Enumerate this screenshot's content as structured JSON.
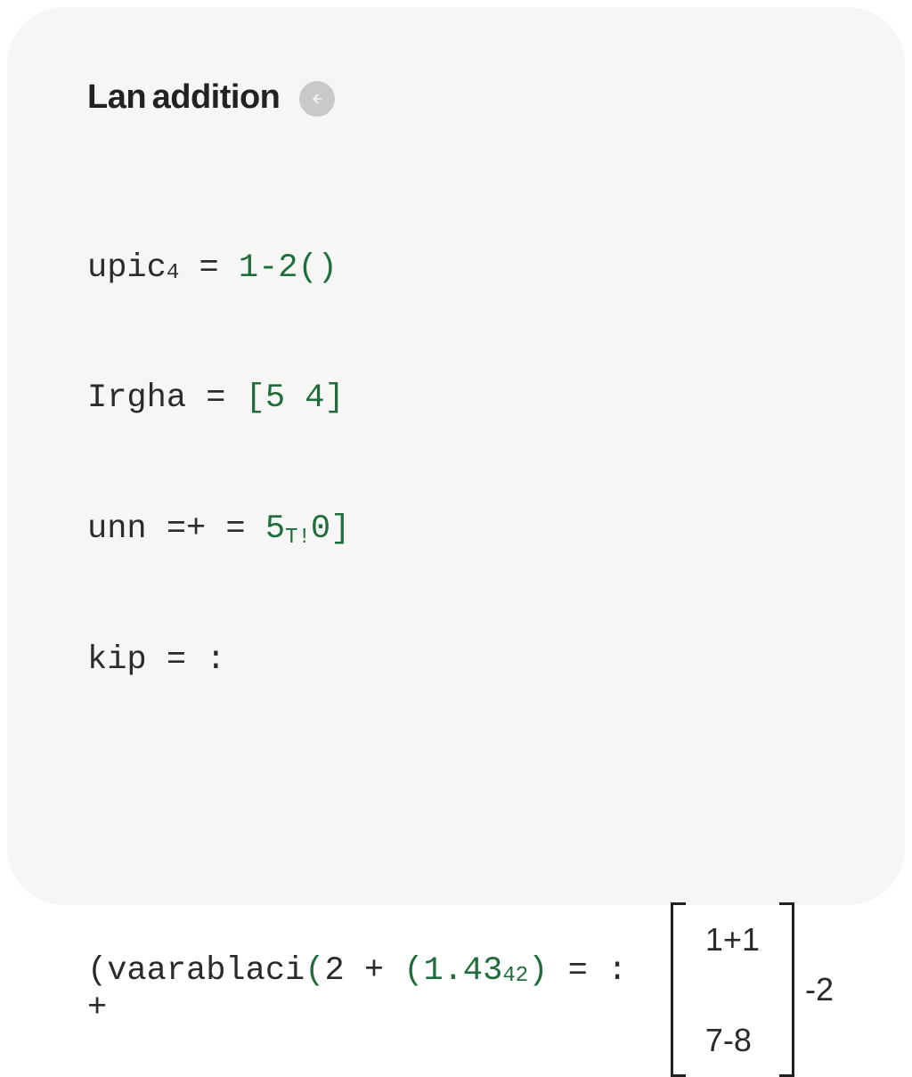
{
  "header": {
    "title_a": "Lan",
    "title_b": "addition"
  },
  "code": {
    "l1a": "upic",
    "l1sub": "4",
    "l1eq": " = ",
    "l1lit": "1-2()",
    "l2a": "Irgha = ",
    "l2lit": "[5 4]",
    "l3a": "unn =+ = ",
    "l3lit_a": "5",
    "l3sub": "T!",
    "l3lit_b": "0]",
    "l4a": "kip = :"
  },
  "formula": {
    "prefix": "(vaarablaci",
    "open": "(",
    "seg1": "2 + ",
    "open2": "(",
    "num": "1.43",
    "numtail": "42",
    "close": ")",
    "tail": " = : + ",
    "matrix_r1": "1+1",
    "matrix_r2": "7-8",
    "after": "-2"
  }
}
